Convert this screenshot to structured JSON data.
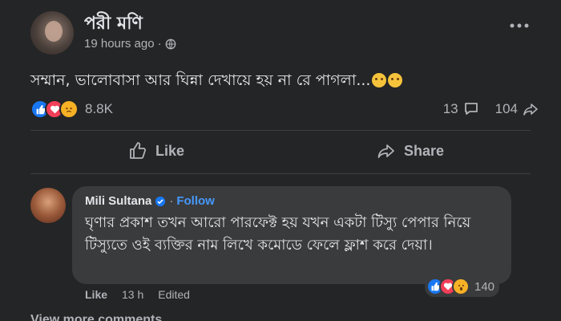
{
  "post": {
    "author": "পরী মণি",
    "time": "19 hours ago",
    "meta_separator": "·",
    "text": "সম্মান, ভালোবাসা আর ঘিন্না দেখায়ে হয় না রে পাগলা...",
    "reactions": [
      "like",
      "love",
      "sad"
    ],
    "reaction_count": "8.8K",
    "comment_count": "13",
    "share_count": "104"
  },
  "actions": {
    "like_label": "Like",
    "share_label": "Share"
  },
  "comment": {
    "author": "Mili Sultana",
    "follow_label": "Follow",
    "separator": "·",
    "text": "ঘৃণার প্রকাশ তখন আরো পারফেক্ট হয় যখন একটা টিস্যু পেপার নিয়ে টিস্যুতে ওই ব্যক্তির নাম লিখে কমোডে ফেলে ফ্লাশ করে দেয়া।",
    "reactions": [
      "like",
      "love",
      "wow"
    ],
    "reaction_count": "140",
    "like_label": "Like",
    "time": "13 h",
    "edited_label": "Edited"
  },
  "view_more": "View more comments",
  "colors": {
    "background": "#242526",
    "bubble": "#3a3b3c",
    "text_primary": "#e4e6eb",
    "text_secondary": "#b0b3b8",
    "link": "#4599ff",
    "like_blue": "#1877f2",
    "love_red": "#f33e58",
    "emoji_yellow": "#f7b125"
  }
}
